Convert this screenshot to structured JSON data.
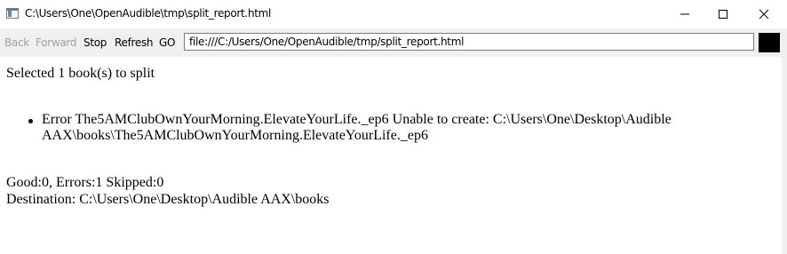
{
  "window": {
    "title": "C:\\Users\\One\\OpenAudible\\tmp\\split_report.html"
  },
  "toolbar": {
    "back_label": "Back",
    "forward_label": "Forward",
    "stop_label": "Stop",
    "refresh_label": "Refresh",
    "go_label": "GO",
    "address_value": "file:///C:/Users/One/OpenAudible/tmp/split_report.html"
  },
  "report": {
    "selected_text": "Selected 1 book(s) to split",
    "errors": [
      {
        "text": "Error The5AMClubOwnYourMorning.ElevateYourLife._ep6 Unable to create: C:\\Users\\One\\Desktop\\Audible AAX\\books\\The5AMClubOwnYourMorning.ElevateYourLife._ep6"
      }
    ],
    "summary_text": "Good:0, Errors:1 Skipped:0",
    "destination_text": "Destination: C:\\Users\\One\\Desktop\\Audible AAX\\books"
  },
  "icons": {
    "app": "browser-window-icon",
    "minimize": "minimize-icon",
    "maximize": "maximize-icon",
    "close": "close-icon",
    "bullet": "bullet-icon"
  }
}
